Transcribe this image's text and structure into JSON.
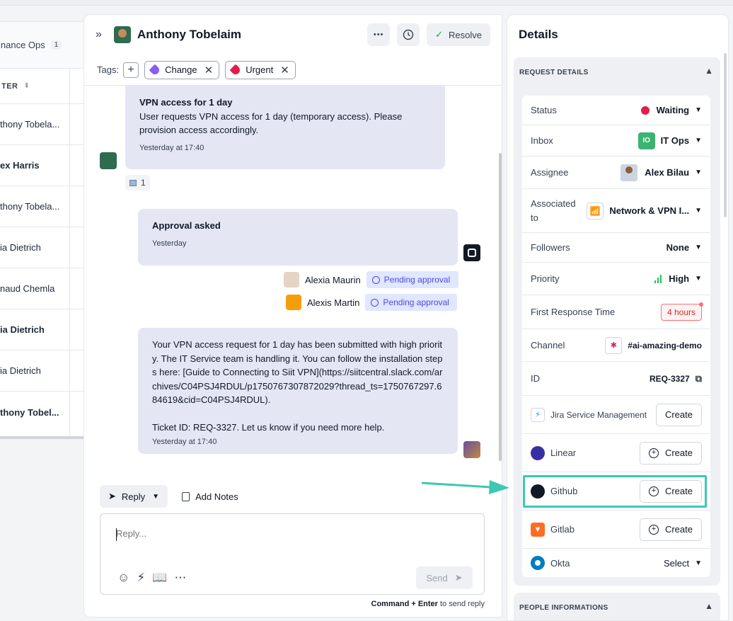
{
  "inbox_list": {
    "inbox_title": "inance Ops",
    "inbox_count": "1",
    "column_header": "TER",
    "rows": [
      {
        "name": "thony Tobela...",
        "bold": false
      },
      {
        "name": "ex Harris",
        "bold": true
      },
      {
        "name": "thony Tobela...",
        "bold": false
      },
      {
        "name": "ia Dietrich",
        "bold": false
      },
      {
        "name": "naud Chemla",
        "bold": false
      },
      {
        "name": "ia Dietrich",
        "bold": true
      },
      {
        "name": "ia Dietrich",
        "bold": false
      },
      {
        "name": "thony Tobel...",
        "bold": true
      }
    ]
  },
  "conversation": {
    "title": "Anthony Tobelaim",
    "more_label": "•••",
    "resolve_label": "Resolve",
    "tags_label": "Tags:",
    "tags": [
      {
        "label": "Change",
        "color": "#8b5cf6"
      },
      {
        "label": "Urgent",
        "color": "#e11d48"
      }
    ],
    "messages": [
      {
        "title": "VPN access for 1 day",
        "body": "User requests VPN access for 1 day (temporary access). Please provision access accordingly.",
        "time": "Yesterday at 17:40",
        "reaction_count": "1"
      },
      {
        "title": "Approval asked",
        "time": "Yesterday"
      },
      {
        "body": "Your VPN access request for 1 day has been submitted with high priority. The IT Service team is handling it. You can follow the installation steps here: [Guide to Connecting to Siit VPN](https://siitcentral.slack.com/archives/C04PSJ4RDUL/p1750767307872029?thread_ts=1750767297.684619&cid=C04PSJ4RDUL).",
        "body2": "Ticket ID: REQ-3327. Let us know if you need more help.",
        "time": "Yesterday at 17:40"
      }
    ],
    "approvers": [
      {
        "name": "Alexia Maurin",
        "status": "Pending approval"
      },
      {
        "name": "Alexis Martin",
        "status": "Pending approval"
      }
    ],
    "composer": {
      "reply_tab": "Reply",
      "notes_tab": "Add Notes",
      "placeholder": "Reply...",
      "send_label": "Send",
      "hint_keys": "Command + Enter",
      "hint_text": "to send reply"
    }
  },
  "details": {
    "title": "Details",
    "section_request": "REQUEST DETAILS",
    "section_people": "PEOPLE INFORMATIONS",
    "fields": {
      "status_label": "Status",
      "status_value": "Waiting",
      "inbox_label": "Inbox",
      "inbox_badge": "IO",
      "inbox_value": "IT Ops",
      "assignee_label": "Assignee",
      "assignee_value": "Alex Bilau",
      "assoc_label_1": "Associated",
      "assoc_label_2": "to",
      "assoc_value": "Network & VPN I...",
      "followers_label": "Followers",
      "followers_value": "None",
      "priority_label": "Priority",
      "priority_value": "High",
      "frt_label": "First Response Time",
      "frt_value": "4 hours",
      "channel_label": "Channel",
      "channel_value": "#ai-amazing-demo",
      "id_label": "ID",
      "id_value": "REQ-3327"
    },
    "integrations": [
      {
        "name": "Jira Service Management",
        "action": "Create",
        "color": "#2684ff"
      },
      {
        "name": "Linear",
        "action": "Create",
        "color": "#4f46e5"
      },
      {
        "name": "Github",
        "action": "Create",
        "color": "#111827"
      },
      {
        "name": "Gitlab",
        "action": "Create",
        "color": "#fc6d26"
      },
      {
        "name": "Okta",
        "action": "Select",
        "color": "#007dc1"
      }
    ],
    "accent_color": "#3cc8b4"
  }
}
